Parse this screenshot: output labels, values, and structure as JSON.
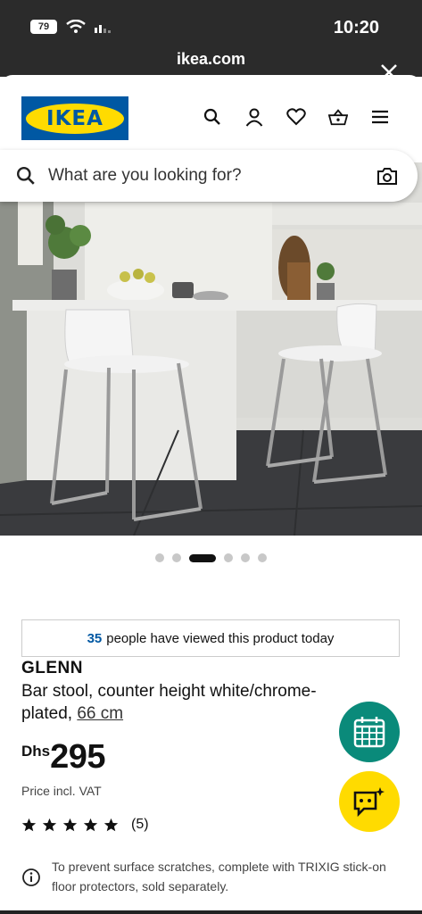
{
  "status": {
    "battery": "79",
    "time": "10:20"
  },
  "browser": {
    "url": "ikea.com"
  },
  "header": {
    "logo_text": "IKEA"
  },
  "search": {
    "placeholder": "What are you looking for?"
  },
  "carousel": {
    "dots": 6,
    "active_index": 2
  },
  "views": {
    "count": "35",
    "text": "people have viewed this product today"
  },
  "product": {
    "name": "GLENN",
    "description": "Bar stool, counter height white/chrome-plated,",
    "size_link": "66 cm",
    "currency": "Dhs",
    "price": "295",
    "vat_note": "Price incl. VAT",
    "rating_stars": 5,
    "review_count": "(5)",
    "note": "To prevent surface scratches, complete with TRIXIG stick-on floor protectors, sold separately."
  },
  "colors": {
    "ikea_blue": "#0058a3",
    "ikea_yellow": "#ffdb00",
    "calendar_fab": "#0a8a7a"
  }
}
